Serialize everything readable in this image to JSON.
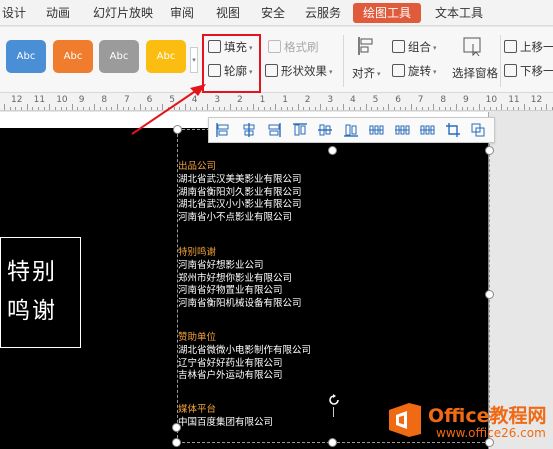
{
  "menu": {
    "tabs": [
      {
        "label": "设计"
      },
      {
        "label": "动画"
      },
      {
        "label": "幻灯片放映"
      },
      {
        "label": "审阅"
      },
      {
        "label": "视图"
      },
      {
        "label": "安全"
      },
      {
        "label": "云服务"
      },
      {
        "label": "绘图工具"
      },
      {
        "label": "文本工具"
      }
    ],
    "active_tab": "绘图工具"
  },
  "ribbon": {
    "style_swatches": [
      {
        "label": "Abc",
        "color": "#4a8ed6"
      },
      {
        "label": "Abc",
        "color": "#ef7d2d"
      },
      {
        "label": "Abc",
        "color": "#9b9b9b"
      },
      {
        "label": "Abc",
        "color": "#fbbd10"
      }
    ],
    "fill_label": "填充",
    "outline_label": "轮廓",
    "format_brush_label": "格式刷",
    "shape_effect_label": "形状效果",
    "align_label": "对齐",
    "group_label": "组合",
    "rotate_label": "旋转",
    "selection_pane_label": "选择窗格",
    "bring_forward_label": "上移一",
    "send_backward_label": "下移一"
  },
  "ruler": {
    "labels": [
      "12",
      "11",
      "10",
      "9",
      "8",
      "7",
      "6",
      "5",
      "4",
      "3",
      "2",
      "1",
      "1",
      "2",
      "3",
      "4",
      "5",
      "6",
      "7",
      "8",
      "9",
      "10",
      "11",
      "12"
    ]
  },
  "slide": {
    "title_lines": [
      "特别",
      "鸣谢"
    ],
    "sections": [
      {
        "heading": "出品公司",
        "items": [
          "湖北省武汉美美影业有限公司",
          "湖南省衡阳刘久影业有限公司",
          "湖北省武汉小小影业有限公司",
          "河南省小不点影业有限公司"
        ]
      },
      {
        "heading": "特别鸣谢",
        "items": [
          "河南省好想影业公司",
          "郑州市好想你影业有限公司",
          "河南省好物置业有限公司",
          "河南省衡阳机械设备有限公司"
        ]
      },
      {
        "heading": "赞助单位",
        "items": [
          "湖北省微微小电影制作有限公司",
          "辽宁省好好药业有限公司",
          "吉林省户外运动有限公司"
        ]
      },
      {
        "heading": "媒体平台",
        "items": [
          "中国百度集团有限公司"
        ]
      }
    ]
  },
  "watermark": {
    "brand": "Office教程网",
    "url": "www.office26.com",
    "logo_color": "#f06a14"
  },
  "colors": {
    "accent_tab": "#e05a3c",
    "highlight_box": "#e3141b",
    "section_heading": "#f0a23a"
  }
}
